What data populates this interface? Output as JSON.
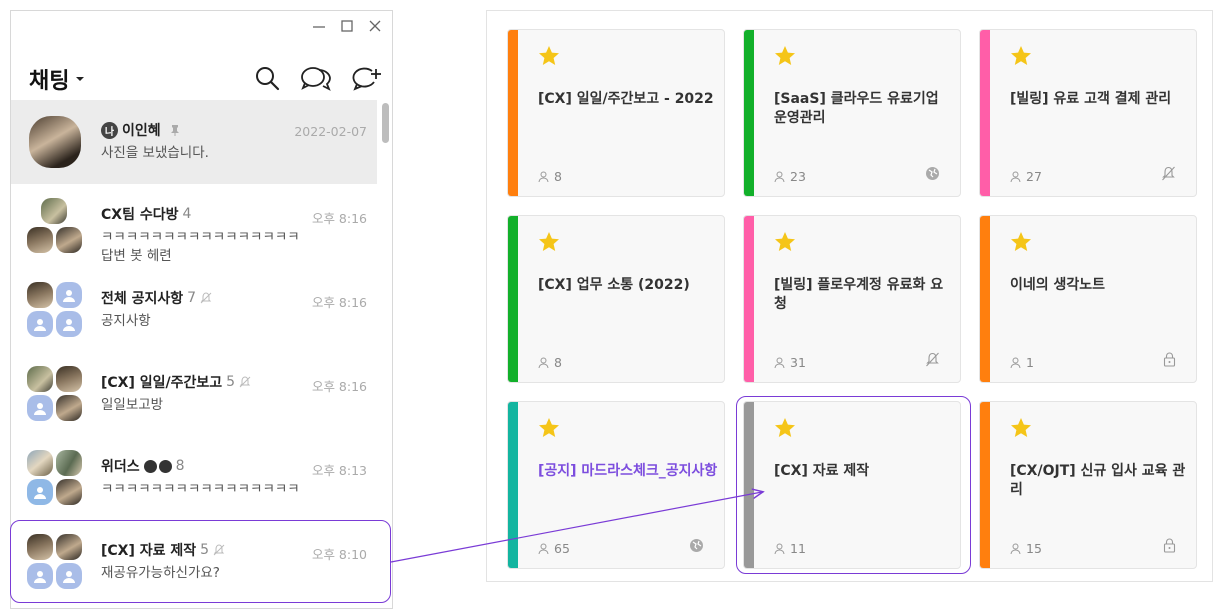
{
  "chat_window": {
    "title": "채팅",
    "window_controls": [
      "minimize-icon",
      "maximize-icon",
      "close-icon"
    ],
    "header_icons": [
      "search-icon",
      "open-chat-icon",
      "new-chat-icon"
    ],
    "rooms": [
      {
        "name": "이인혜",
        "badge": "나",
        "message": "사진을 보냈습니다.",
        "time": "2022-02-07",
        "pinned": true,
        "selected": true
      },
      {
        "name": "CX팀 수다방",
        "count": "4",
        "message": "ㅋㅋㅋㅋㅋㅋㅋㅋㅋㅋㅋㅋㅋㅋㅋㅋ 답변 봇 헤련",
        "time": "오후 8:16"
      },
      {
        "name": "전체 공지사항",
        "count": "7",
        "message": "공지사항",
        "time": "오후 8:16",
        "muted": true
      },
      {
        "name": "[CX] 일일/주간보고",
        "count": "5",
        "message": "일일보고방",
        "time": "오후 8:16",
        "muted": true
      },
      {
        "name": "위더스",
        "emoji": "🅟🅟",
        "count": "8",
        "message": "ㅋㅋㅋㅋㅋㅋㅋㅋㅋㅋㅋㅋㅋㅋㅋㅋ",
        "time": "오후 8:13"
      },
      {
        "name": "[CX] 자료 제작",
        "count": "5",
        "message": "재공유가능하신가요?",
        "time": "오후 8:10",
        "muted": true
      }
    ]
  },
  "board": {
    "cards": [
      {
        "title": "[CX] 일일/주간보고 - 2022",
        "members": "8",
        "color": "#ff7f0e",
        "icon": ""
      },
      {
        "title": "[SaaS] 클라우드 유료기업 운영관리",
        "members": "23",
        "color": "#12b02a",
        "icon": "globe-icon"
      },
      {
        "title": "[빌링] 유료 고객 결제 관리",
        "members": "27",
        "color": "#ff5ea8",
        "icon": "bell-off-icon"
      },
      {
        "title": "[CX] 업무 소통 (2022)",
        "members": "8",
        "color": "#12b02a",
        "icon": ""
      },
      {
        "title": "[빌링] 플로우계정 유료화 요청",
        "members": "31",
        "color": "#ff5ea8",
        "icon": "bell-off-icon"
      },
      {
        "title": "이네의 생각노트",
        "members": "1",
        "color": "#ff7f0e",
        "icon": "lock-icon"
      },
      {
        "title": "[공지] 마드라스체크_공지사항",
        "members": "65",
        "color": "#13b5a0",
        "icon": "globe-icon",
        "notice": true
      },
      {
        "title": "[CX] 자료 제작",
        "members": "11",
        "color": "#999999",
        "icon": "",
        "highlighted": true
      },
      {
        "title": "[CX/OJT] 신규 입사 교육 관리",
        "members": "15",
        "color": "#ff7f0e",
        "icon": "lock-icon"
      }
    ],
    "star_color": "#f5c518",
    "highlight_color": "#7a3bd6"
  }
}
